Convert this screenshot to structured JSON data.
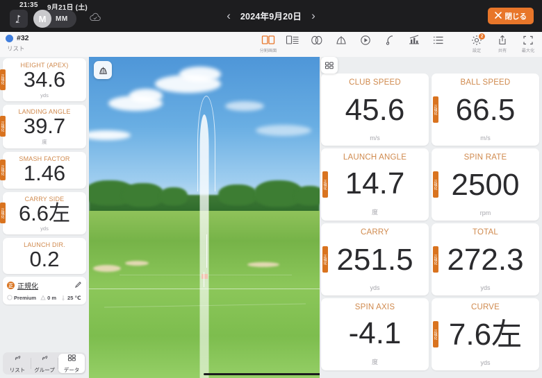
{
  "statusbar": {
    "time": "21:35",
    "date": "9月21日 (土)"
  },
  "topbar": {
    "app_icon": "golf-swing-icon",
    "avatar_initial": "M",
    "avatar_name": "MM",
    "cloud_icon": "cloud-check-icon",
    "prev_label": "‹",
    "next_label": "›",
    "date_label": "2024年9月20日",
    "close_label": "閉じる",
    "close_icon": "close-x-icon",
    "accent": "#e8762a"
  },
  "toolbar": {
    "shot_id": "#32",
    "shot_sub": "リスト",
    "shot_dot_color": "#3f7ddc",
    "center_tools": [
      {
        "name": "split-screen-icon",
        "caption": "分割画面"
      },
      {
        "name": "table-layout-icon",
        "caption": ""
      },
      {
        "name": "ball-flight-icon",
        "caption": ""
      },
      {
        "name": "trajectory-icon",
        "caption": ""
      },
      {
        "name": "play-video-icon",
        "caption": ""
      },
      {
        "name": "club-path-icon",
        "caption": ""
      },
      {
        "name": "stats-chart-icon",
        "caption": ""
      },
      {
        "name": "list-icon",
        "caption": ""
      }
    ],
    "right_tools": [
      {
        "name": "gear-icon",
        "caption": "設定",
        "badge": "2"
      },
      {
        "name": "share-icon",
        "caption": "共有",
        "badge": ""
      },
      {
        "name": "maximize-icon",
        "caption": "最大化",
        "badge": ""
      }
    ]
  },
  "left_metrics": [
    {
      "label": "HEIGHT (APEX)",
      "value": "34.6",
      "unit": "yds",
      "tab": "正規化"
    },
    {
      "label": "LANDING ANGLE",
      "value": "39.7",
      "unit": "度",
      "tab": "正規化"
    },
    {
      "label": "SMASH FACTOR",
      "value": "1.46",
      "unit": "",
      "tab": "正規化"
    },
    {
      "label": "CARRY SIDE",
      "value": "6.6左",
      "unit": "yds",
      "tab": "正規化"
    },
    {
      "label": "LAUNCH DIR.",
      "value": "0.2",
      "unit": "",
      "tab": ""
    }
  ],
  "normalize": {
    "icon": "normalize-icon",
    "badge_char": "正",
    "label": "正規化",
    "edit_icon": "pencil-icon",
    "chips": [
      {
        "icon": "ball-icon",
        "text": "Premium"
      },
      {
        "icon": "altitude-icon",
        "text": "0 m"
      },
      {
        "icon": "thermometer-icon",
        "text": "25 ℃"
      }
    ]
  },
  "bottom_tabs": [
    {
      "label": "リスト",
      "icon": "list-link-icon",
      "active": false
    },
    {
      "label": "グループ",
      "icon": "group-link-icon",
      "active": false
    },
    {
      "label": "データ",
      "icon": "data-grid-icon",
      "active": true
    }
  ],
  "sim": {
    "overlay_button_icon": "shot-shape-icon",
    "grid_button_icon": "grid-layout-icon"
  },
  "right_metrics": [
    {
      "label": "CLUB SPEED",
      "value": "45.6",
      "unit": "m/s",
      "tab": ""
    },
    {
      "label": "BALL SPEED",
      "value": "66.5",
      "unit": "m/s",
      "tab": "正規化"
    },
    {
      "label": "LAUNCH ANGLE",
      "value": "14.7",
      "unit": "度",
      "tab": "正規化"
    },
    {
      "label": "SPIN RATE",
      "value": "2500",
      "unit": "rpm",
      "tab": "正規化"
    },
    {
      "label": "CARRY",
      "value": "251.5",
      "unit": "yds",
      "tab": "正規化"
    },
    {
      "label": "TOTAL",
      "value": "272.3",
      "unit": "yds",
      "tab": "正規化"
    },
    {
      "label": "SPIN AXIS",
      "value": "-4.1",
      "unit": "度",
      "tab": ""
    },
    {
      "label": "CURVE",
      "value": "7.6左",
      "unit": "yds",
      "tab": "正規化"
    }
  ]
}
